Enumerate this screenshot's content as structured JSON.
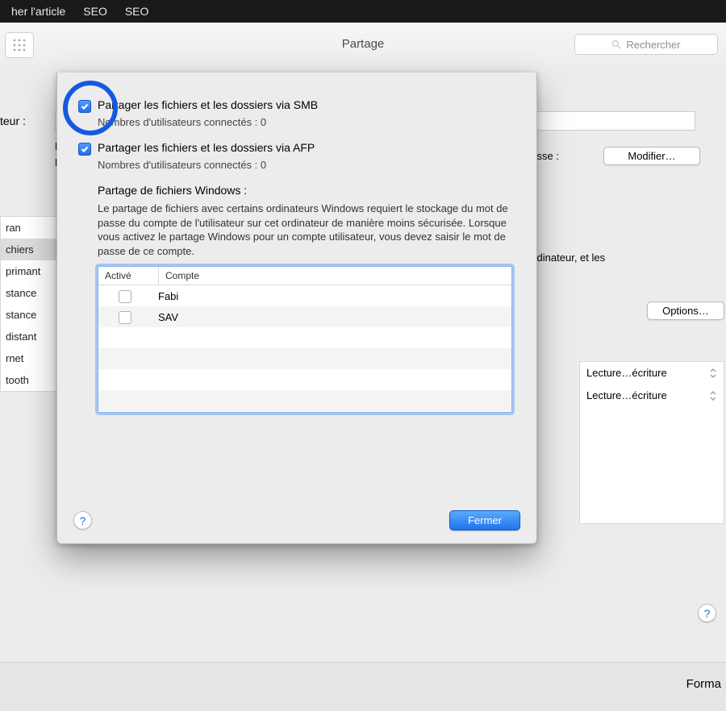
{
  "menubar": {
    "items": [
      "her l'article",
      "SEO",
      "SEO"
    ]
  },
  "toolbar": {
    "title": "Partage",
    "search_placeholder": "Rechercher"
  },
  "prefs": {
    "computer_label": "teur :",
    "l_line": "L",
    "f_line": "F",
    "address_label": "resse :",
    "modify_btn": "Modifier…",
    "right_text": "ordinateur, et les",
    "options_btn": "Options…"
  },
  "sidebar": {
    "items": [
      "ran",
      "chiers",
      "primant",
      "stance",
      "stance",
      " distant",
      "rnet",
      "tooth"
    ],
    "selected_index": 1
  },
  "perm": {
    "rows": [
      "Lecture…écriture",
      "Lecture…écriture"
    ]
  },
  "bottom": {
    "label": "Forma"
  },
  "sheet": {
    "smb_label": "Partager les fichiers et les dossiers via SMB",
    "smb_info": "Nombres d'utilisateurs connectés : 0",
    "afp_label": "Partager les fichiers et les dossiers via AFP",
    "afp_info": "Nombres d'utilisateurs connectés : 0",
    "win_title": "Partage de fichiers Windows :",
    "win_desc": "Le partage de fichiers avec certains ordinateurs Windows requiert le stockage du mot de passe du compte de l'utilisateur sur cet ordinateur de manière moins sécurisée. Lorsque vous activez le partage Windows pour un compte utilisateur, vous devez saisir le mot de passe de ce compte.",
    "col_on": "Activé",
    "col_acct": "Compte",
    "accounts": [
      {
        "on": false,
        "name": "Fabi"
      },
      {
        "on": false,
        "name": "SAV"
      }
    ],
    "close": "Fermer",
    "help": "?"
  }
}
